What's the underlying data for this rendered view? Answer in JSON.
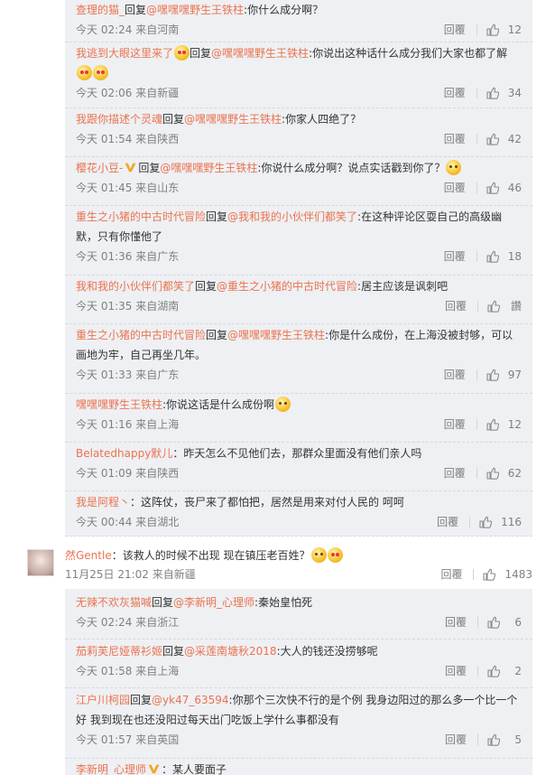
{
  "panel1": [
    {
      "nick": "查理的猫_",
      "reply_label": "回复",
      "at": "@嘿嘿嘿野生王铁柱",
      "text": ":你什么成分啊？",
      "emojis": [],
      "time": "今天 02:24 来自河南",
      "reply_btn": "回覆",
      "likes": "12"
    },
    {
      "nick": "我逃到大眼这里来了",
      "nick_emoji": "heart",
      "reply_label": "回复",
      "at": "@嘿嘿嘿野生王铁柱",
      "text": ":你说出这种话什么成分我们大家也都了解",
      "emojis": [
        "heart",
        "heart"
      ],
      "time": "今天 02:06 来自新疆",
      "reply_btn": "回覆",
      "likes": "34"
    },
    {
      "nick": "我跟你描述个灵魂",
      "reply_label": "回复",
      "at": "@嘿嘿嘿野生王铁柱",
      "text": ":你家人四绝了？",
      "emojis": [],
      "time": "今天 01:54 来自陕西",
      "reply_btn": "回覆",
      "likes": "42"
    },
    {
      "nick": "樱花小豆-",
      "vip": true,
      "reply_label": "回复",
      "at": "@嘿嘿嘿野生王铁柱",
      "text": ":你说什么成分啊？说点实话戳到你了？",
      "emojis": [
        "smile"
      ],
      "time": "今天 01:45 来自山东",
      "reply_btn": "回覆",
      "likes": "46"
    },
    {
      "nick": "重生之小猪的中古时代冒险",
      "reply_label": "回复",
      "at": "@我和我的小伙伴们都笑了",
      "text": ":在这种评论区耍自己的高级幽默，只有你懂他了",
      "emojis": [],
      "time": "今天 01:36 来自广东",
      "reply_btn": "回覆",
      "likes": "18"
    },
    {
      "nick": "我和我的小伙伴们都笑了",
      "reply_label": "回复",
      "at": "@重生之小猪的中古时代冒险",
      "text": ":居主应该是讽刺吧",
      "emojis": [],
      "time": "今天 01:35 来自湖南",
      "reply_btn": "回覆",
      "likes": "讚"
    },
    {
      "nick": "重生之小猪的中古时代冒险",
      "reply_label": "回复",
      "at": "@嘿嘿嘿野生王铁柱",
      "text": ":你是什么成份，在上海没被封够，可以画地为牢，自己再坐几年。",
      "emojis": [],
      "time": "今天 01:33 来自广东",
      "reply_btn": "回覆",
      "likes": "97"
    },
    {
      "nick": "嘿嘿嘿野生王铁柱",
      "reply_label": "",
      "at": "",
      "text": ":你说这话是什么成份啊",
      "emojis": [
        "party"
      ],
      "time": "今天 01:16 来自上海",
      "reply_btn": "回覆",
      "likes": "12"
    },
    {
      "nick": "Belatedhappy默儿",
      "reply_label": "",
      "at": "",
      "text": "：昨天怎么不见他们去，那群众里面没有他们亲人吗",
      "emojis": [],
      "time": "今天 01:09 来自陕西",
      "reply_btn": "回覆",
      "likes": "62"
    },
    {
      "nick": "我是阿程丶",
      "reply_label": "",
      "at": "",
      "text": "：这阵仗，丧尸来了都怕把，居然是用来对付人民的 呵呵",
      "emojis": [],
      "time": "今天 00:44 来自湖北",
      "reply_btn": "回覆",
      "likes": "116"
    }
  ],
  "main_comment": {
    "nick": "然Gentle",
    "text": "：该救人的时候不出现 现在镇压老百姓？",
    "emojis": [
      "smile",
      "heart"
    ],
    "time": "11月25日 21:02 来自新疆",
    "reply_btn": "回覆",
    "likes": "1483"
  },
  "panel2": [
    {
      "nick": "无辣不欢灰猫喊",
      "reply_label": "回复",
      "at": "@李新明_心理师",
      "text": ":秦始皇怕死",
      "emojis": [],
      "time": "今天 02:24 来自浙江",
      "reply_btn": "回覆",
      "likes": "6"
    },
    {
      "nick": "茄莉芙尼娅蒂衫姬",
      "reply_label": "回复",
      "at": "@采莲南塘秋2018",
      "text": ":大人的钱还没捞够呢",
      "emojis": [],
      "time": "今天 01:58 来自上海",
      "reply_btn": "回覆",
      "likes": "2"
    },
    {
      "nick": "江户川柯园",
      "reply_label": "回复",
      "at": "@yk47_63594",
      "text": ":你那个三次快不行的是个例 我身边阳过的那么多一个比一个好 我到现在也还没阳过每天出门吃饭上学什么事都没有",
      "emojis": [],
      "time": "今天 01:57 来自英国",
      "reply_btn": "回覆",
      "likes": "5"
    },
    {
      "nick": "李新明_心理师",
      "vip": true,
      "reply_label": "",
      "at": "",
      "text": "：某人要面子",
      "emojis": [],
      "time": "",
      "reply_btn": "",
      "likes": ""
    }
  ],
  "colors": {
    "link": "#eb7350",
    "meta": "#808080",
    "panel_bg": "#eef0f3",
    "text": "#333333"
  },
  "icons": {
    "like": "thumbs-up-icon",
    "vip": "vip-v-icon",
    "emoji": "emoji-icon"
  }
}
